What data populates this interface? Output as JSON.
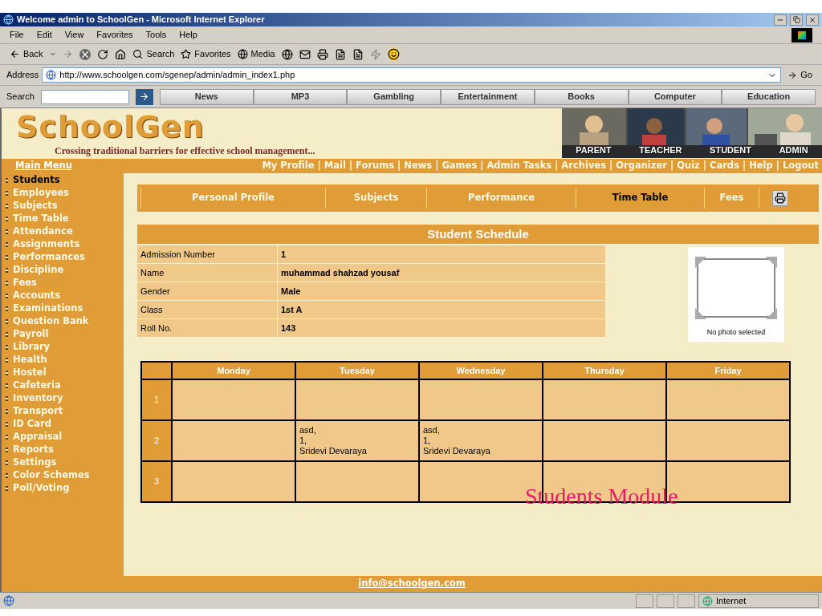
{
  "browser": {
    "title": "Welcome admin to SchoolGen - Microsoft Internet Explorer",
    "menu": [
      "File",
      "Edit",
      "View",
      "Favorites",
      "Tools",
      "Help"
    ],
    "toolbar": {
      "back": "Back",
      "search": "Search",
      "favorites": "Favorites",
      "media": "Media"
    },
    "address": {
      "label": "Address",
      "url": "http://www.schoolgen.com/sgenep/admin/admin_index1.php",
      "go": "Go"
    },
    "search_bar": {
      "label": "Search",
      "links": [
        "News",
        "MP3",
        "Gambling",
        "Entertainment",
        "Books",
        "Computer",
        "Education"
      ]
    },
    "status_bar": {
      "zone": "Internet"
    }
  },
  "site": {
    "logo": "SchoolGen",
    "tagline": "Crossing traditional barriers for effective school management...",
    "banner_labels": [
      "PARENT",
      "TEACHER",
      "STUDENT",
      "ADMIN"
    ],
    "main_menu_title": "Main Menu",
    "separator": "|",
    "top_links": [
      "My Profile",
      "Mail",
      "Forums",
      "News",
      "Games",
      "Admin Tasks",
      "Archives",
      "Organizer",
      "Quiz",
      "Cards",
      "Help",
      "Logout"
    ],
    "sidebar": [
      {
        "label": "Students",
        "selected": true
      },
      {
        "label": "Employees",
        "selected": false
      },
      {
        "label": "Subjects",
        "selected": false
      },
      {
        "label": "Time Table",
        "selected": false
      },
      {
        "label": "Attendance",
        "selected": false
      },
      {
        "label": "Assignments",
        "selected": false
      },
      {
        "label": "Performances",
        "selected": false
      },
      {
        "label": "Discipline",
        "selected": false
      },
      {
        "label": "Fees",
        "selected": false
      },
      {
        "label": "Accounts",
        "selected": false
      },
      {
        "label": "Examinations",
        "selected": false
      },
      {
        "label": "Question Bank",
        "selected": false
      },
      {
        "label": "Payroll",
        "selected": false
      },
      {
        "label": "Library",
        "selected": false
      },
      {
        "label": "Health",
        "selected": false
      },
      {
        "label": "Hostel",
        "selected": false
      },
      {
        "label": "Cafeteria",
        "selected": false
      },
      {
        "label": "Inventory",
        "selected": false
      },
      {
        "label": "Transport",
        "selected": false
      },
      {
        "label": "ID Card",
        "selected": false
      },
      {
        "label": "Appraisal",
        "selected": false
      },
      {
        "label": "Reports",
        "selected": false
      },
      {
        "label": "Settings",
        "selected": false
      },
      {
        "label": "Color Schemes",
        "selected": false
      },
      {
        "label": "Poll/Voting",
        "selected": false
      }
    ],
    "tabs": [
      {
        "label": "Personal Profile",
        "selected": false
      },
      {
        "label": "Subjects",
        "selected": false
      },
      {
        "label": "Performance",
        "selected": false
      },
      {
        "label": "Time Table",
        "selected": true
      },
      {
        "label": "Fees",
        "selected": false
      }
    ],
    "schedule_title": "Student Schedule",
    "fields": [
      {
        "label": "Admission Number",
        "value": "1"
      },
      {
        "label": "Name",
        "value": "muhammad shahzad  yousaf"
      },
      {
        "label": "Gender",
        "value": "Male"
      },
      {
        "label": "Class",
        "value": "1st A"
      },
      {
        "label": "Roll No.",
        "value": "143"
      }
    ],
    "photo_caption": "No photo selected",
    "timetable": {
      "columns": [
        "Monday",
        "Tuesday",
        "Wednesday",
        "Thursday",
        "Friday"
      ],
      "rows": [
        {
          "period": "1",
          "cells": [
            [],
            [],
            [],
            [],
            []
          ]
        },
        {
          "period": "2",
          "cells": [
            [],
            [
              "asd,",
              "1,",
              "Sridevi Devaraya"
            ],
            [
              "asd,",
              "1,",
              "Sridevi Devaraya"
            ],
            [],
            []
          ]
        },
        {
          "period": "3",
          "cells": [
            [],
            [],
            [],
            [],
            []
          ]
        }
      ]
    },
    "overlay_caption": "Students Module",
    "footer_email": "info@schoolgen.com"
  }
}
